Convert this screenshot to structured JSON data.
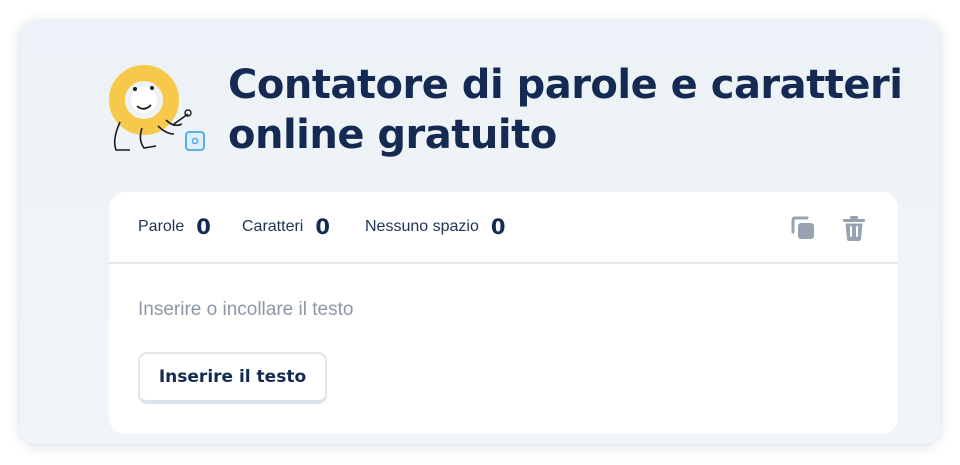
{
  "header": {
    "title": "Contatore di parole e caratteri online gratuito"
  },
  "stats": {
    "words_label": "Parole",
    "words_value": "0",
    "chars_label": "Caratteri",
    "chars_value": "0",
    "nospace_label": "Nessuno spazio",
    "nospace_value": "0"
  },
  "toolbar": {
    "copy_icon": "copy-icon",
    "delete_icon": "trash-icon"
  },
  "editor": {
    "placeholder": "Inserire o incollare il testo",
    "value": ""
  },
  "actions": {
    "insert_label": "Inserire il testo"
  },
  "colors": {
    "title": "#142a52",
    "mascot_yellow": "#f6c94a",
    "accent_blue": "#4aa8ea",
    "icon_gray": "#97a3b1",
    "background": "#eef3f7"
  }
}
